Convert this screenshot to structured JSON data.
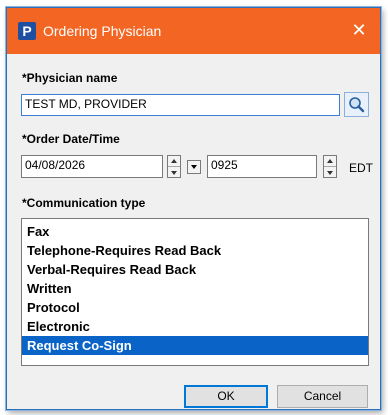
{
  "window": {
    "title": "Ordering Physician",
    "app_icon_letter": "P",
    "close_glyph": "✕",
    "titlebar_color": "#f26522"
  },
  "physician": {
    "label": "*Physician name",
    "value": "TEST MD, PROVIDER",
    "search_icon": "magnifier-icon"
  },
  "order": {
    "label": "*Order Date/Time",
    "date": "04/08/2026",
    "time": "0925",
    "timezone": "EDT"
  },
  "communication": {
    "label": "*Communication type",
    "items": [
      "Fax",
      "Telephone-Requires Read Back",
      "Verbal-Requires Read Back",
      "Written",
      "Protocol",
      "Electronic",
      "Request Co-Sign"
    ],
    "selected": "Request Co-Sign",
    "selection_color": "#0a64c8"
  },
  "buttons": {
    "ok": "OK",
    "cancel": "Cancel"
  }
}
